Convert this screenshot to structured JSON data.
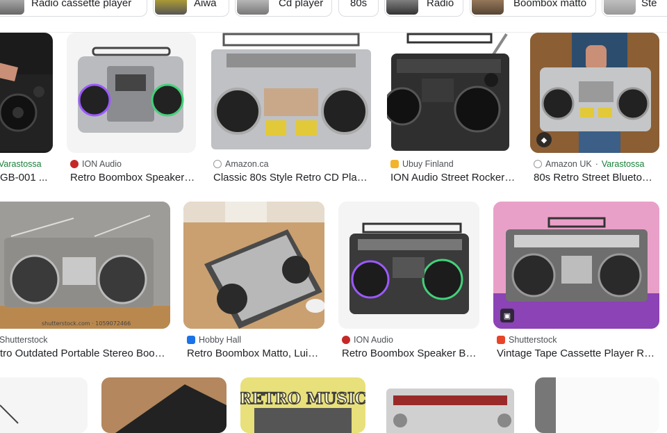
{
  "chips": [
    {
      "label": "Radio cassette player"
    },
    {
      "label": "Aiwa"
    },
    {
      "label": "Cd player"
    },
    {
      "label": "80s"
    },
    {
      "label": "Radio"
    },
    {
      "label": "Boombox matto"
    },
    {
      "label": "Ste"
    }
  ],
  "results": [
    {
      "source": "",
      "source_extra": "Varastossa",
      "title": "GB-001 ..."
    },
    {
      "source": "ION Audio",
      "source_extra": "",
      "title": "Retro Boombox Speaker…"
    },
    {
      "source": "Amazon.ca",
      "source_extra": "",
      "title": "Classic 80s Style Retro CD Play…"
    },
    {
      "source": "Ubuy Finland",
      "source_extra": "",
      "title": "ION Audio Street Rocker…"
    },
    {
      "source": "Amazon UK",
      "source_extra": "Varastossa",
      "separator": " · ",
      "title": "80s Retro Street Blueto…"
    },
    {
      "source": "Shutterstock",
      "source_extra": "",
      "title": "tro Outdated Portable Stereo Boo…",
      "watermark": "shutterstock.com · 1059072466"
    },
    {
      "source": "Hobby Hall",
      "source_extra": "",
      "title": "Retro Boombox Matto, Luis…"
    },
    {
      "source": "ION Audio",
      "source_extra": "",
      "title": "Retro Boombox Speaker Bl…"
    },
    {
      "source": "Shutterstock",
      "source_extra": "",
      "title": "Vintage Tape Cassette Player R…"
    },
    {
      "title": ""
    },
    {
      "title": ""
    },
    {
      "title": "",
      "image_text": "RETRO MUSIC"
    },
    {
      "title": ""
    },
    {
      "title": ""
    }
  ],
  "colors": {
    "accent_green": "#188038",
    "text": "#202124",
    "muted": "#4d5156"
  }
}
